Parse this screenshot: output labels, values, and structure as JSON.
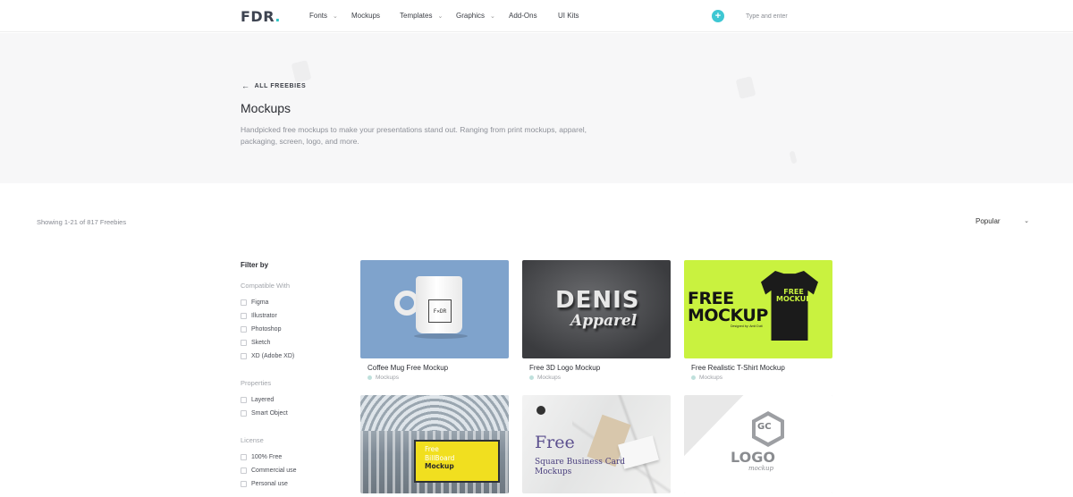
{
  "nav": {
    "logo": "FDR",
    "logo_dot": ".",
    "items": [
      {
        "label": "Fonts",
        "has_dropdown": true
      },
      {
        "label": "Mockups",
        "has_dropdown": false
      },
      {
        "label": "Templates",
        "has_dropdown": true
      },
      {
        "label": "Graphics",
        "has_dropdown": true
      },
      {
        "label": "Add-Ons",
        "has_dropdown": false
      },
      {
        "label": "UI Kits",
        "has_dropdown": false
      }
    ],
    "plus_icon": "+",
    "search_placeholder": "Type and enter",
    "accent_color": "#3ec7d3"
  },
  "hero": {
    "back_label": "ALL FREEBIES",
    "title": "Mockups",
    "description": "Handpicked free mockups to make your presentations stand out. Ranging from print mockups, apparel, packaging, screen, logo, and more."
  },
  "results": {
    "showing": "Showing 1-21 of 817 Freebies",
    "sort_value": "Popular"
  },
  "filters": {
    "title": "Filter by",
    "groups": [
      {
        "title": "Compatible With",
        "options": [
          "Figma",
          "Illustrator",
          "Photoshop",
          "Sketch",
          "XD (Adobe XD)"
        ]
      },
      {
        "title": "Properties",
        "options": [
          "Layered",
          "Smart Object"
        ]
      },
      {
        "title": "License",
        "options": [
          "100% Free",
          "Commercial use",
          "Personal use"
        ]
      }
    ]
  },
  "cards": [
    {
      "title": "Coffee Mug Free Mockup",
      "category": "Mockups",
      "thumb_text": [
        "F",
        "D",
        "R",
        "✕"
      ]
    },
    {
      "title": "Free 3D Logo Mockup",
      "category": "Mockups",
      "thumb_text": [
        "DENIS",
        "Apparel"
      ]
    },
    {
      "title": "Free Realistic T-Shirt Mockup",
      "category": "Mockups",
      "thumb_text": [
        "FREE",
        "MOCKUP",
        "Designed by: Amit Dutt",
        "FREE",
        "MOCKUP"
      ]
    },
    {
      "title": "",
      "category": "",
      "thumb_text": [
        "Free",
        "BillBoard",
        "Mockup"
      ]
    },
    {
      "title": "",
      "category": "",
      "thumb_text": [
        "Free",
        "Square Business Card",
        "Mockups"
      ]
    },
    {
      "title": "",
      "category": "",
      "thumb_text": [
        "GC",
        "LOGO",
        "mockup"
      ]
    }
  ]
}
